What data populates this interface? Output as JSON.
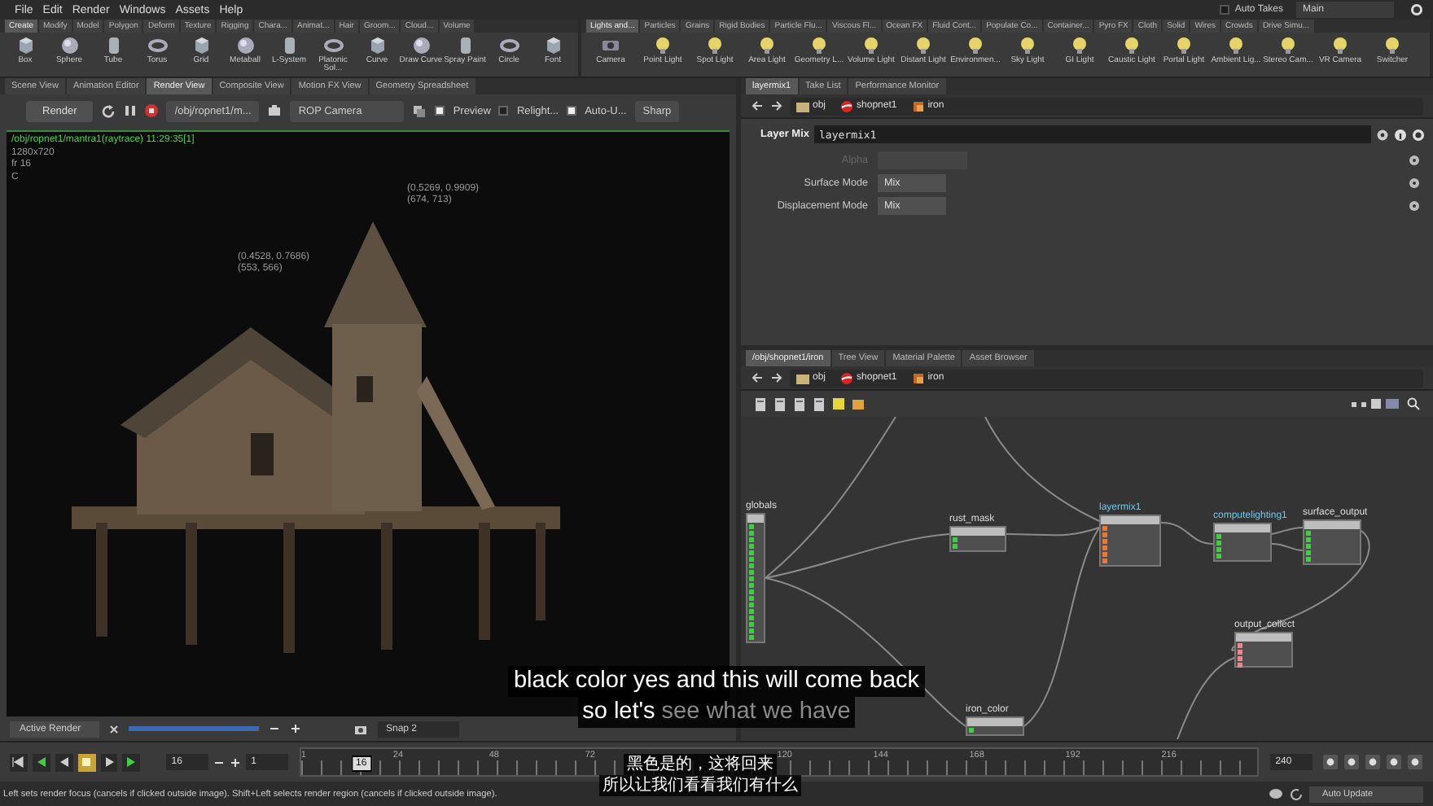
{
  "menu": [
    "File",
    "Edit",
    "Render",
    "Windows",
    "Assets",
    "Help"
  ],
  "auto_takes": {
    "label": "Auto Takes",
    "checked": false
  },
  "desktop": "Main",
  "shelves": [
    {
      "tabs": [
        {
          "label": "Create",
          "selected": true
        },
        {
          "label": "Modify",
          "selected": false
        },
        {
          "label": "Model",
          "selected": false
        },
        {
          "label": "Polygon",
          "selected": false
        },
        {
          "label": "Deform",
          "selected": false
        },
        {
          "label": "Texture",
          "selected": false
        },
        {
          "label": "Rigging",
          "selected": false
        },
        {
          "label": "Chara...",
          "selected": false
        },
        {
          "label": "Animat...",
          "selected": false
        },
        {
          "label": "Hair",
          "selected": false
        },
        {
          "label": "Groom...",
          "selected": false
        },
        {
          "label": "Cloud...",
          "selected": false
        },
        {
          "label": "Volume",
          "selected": false
        }
      ],
      "tools": [
        "Box",
        "Sphere",
        "Tube",
        "Torus",
        "Grid",
        "Metaball",
        "L-System",
        "Platonic Sol...",
        "Curve",
        "Draw Curve",
        "Spray Paint",
        "Circle",
        "Font"
      ]
    },
    {
      "tabs": [
        {
          "label": "Lights and...",
          "selected": true
        },
        {
          "label": "Particles",
          "selected": false
        },
        {
          "label": "Grains",
          "selected": false
        },
        {
          "label": "Rigid Bodies",
          "selected": false
        },
        {
          "label": "Particle Flu...",
          "selected": false
        },
        {
          "label": "Viscous Fl...",
          "selected": false
        },
        {
          "label": "Ocean FX",
          "selected": false
        },
        {
          "label": "Fluid Cont...",
          "selected": false
        },
        {
          "label": "Populate Co...",
          "selected": false
        },
        {
          "label": "Container...",
          "selected": false
        },
        {
          "label": "Pyro FX",
          "selected": false
        },
        {
          "label": "Cloth",
          "selected": false
        },
        {
          "label": "Solid",
          "selected": false
        },
        {
          "label": "Wires",
          "selected": false
        },
        {
          "label": "Crowds",
          "selected": false
        },
        {
          "label": "Drive Simu...",
          "selected": false
        }
      ],
      "tools": [
        "Camera",
        "Point Light",
        "Spot Light",
        "Area Light",
        "Geometry L...",
        "Volume Light",
        "Distant Light",
        "Environmen...",
        "Sky Light",
        "GI Light",
        "Caustic Light",
        "Portal Light",
        "Ambient Lig...",
        "Stereo Cam...",
        "VR Camera",
        "Switcher"
      ]
    }
  ],
  "render_pane": {
    "tabs": [
      {
        "label": "Scene View",
        "selected": false
      },
      {
        "label": "Animation Editor",
        "selected": false
      },
      {
        "label": "Render View",
        "selected": true
      },
      {
        "label": "Composite View",
        "selected": false
      },
      {
        "label": "Motion FX View",
        "selected": false
      },
      {
        "label": "Geometry Spreadsheet",
        "selected": false
      }
    ],
    "render_button": "Render",
    "rop_path": "/obj/ropnet1/m...",
    "camera": "ROP Camera",
    "options": [
      {
        "label": "Preview",
        "checked": true
      },
      {
        "label": "Relight...",
        "checked": false
      },
      {
        "label": "Auto-U...",
        "checked": true
      }
    ],
    "quality": "Sharp",
    "info": [
      "/obj/ropnet1/mantra1(raytrace) 11:29:35[1]",
      "1280x720",
      "fr 16",
      "C"
    ],
    "probes": [
      [
        "(0.5269, 0.9909)",
        "(674, 713)"
      ],
      [
        "(0.4528, 0.7686)",
        "(553, 566)"
      ]
    ],
    "active_render": "Active Render",
    "progress": {
      "level": 1
    },
    "snap": "Snap 2"
  },
  "param_pane": {
    "tabs": [
      {
        "label": "layermix1",
        "selected": true
      },
      {
        "label": "Take List",
        "selected": false
      },
      {
        "label": "Performance Monitor",
        "selected": false
      }
    ],
    "path": [
      "obj",
      "shopnet1",
      "iron"
    ],
    "node_type": "Layer Mix",
    "node_name": "layermix1",
    "params": [
      {
        "label": "Alpha",
        "disabled": true
      },
      {
        "label": "Surface Mode",
        "value": "Mix",
        "disabled": false
      },
      {
        "label": "Displacement Mode",
        "value": "Mix",
        "disabled": false
      }
    ]
  },
  "network_pane": {
    "tabs": [
      {
        "label": "/obj/shopnet1/iron",
        "selected": true
      },
      {
        "label": "Tree View",
        "selected": false
      },
      {
        "label": "Material Palette",
        "selected": false
      },
      {
        "label": "Asset Browser",
        "selected": false
      }
    ],
    "path": [
      "obj",
      "shopnet1",
      "iron"
    ],
    "nodes": [
      {
        "name": "globals",
        "kind": "globals"
      },
      {
        "name": "rust_mask",
        "kind": "small"
      },
      {
        "name": "layermix1",
        "kind": "mix"
      },
      {
        "name": "computelighting1",
        "kind": "light"
      },
      {
        "name": "surface_output",
        "kind": "output"
      },
      {
        "name": "output_collect",
        "kind": "collect"
      },
      {
        "name": "iron_color",
        "kind": "small"
      }
    ]
  },
  "timeline": {
    "frame": "16",
    "start": "1",
    "end": "240",
    "current": "16",
    "level": 0.063,
    "ticks": [
      "1",
      "24",
      "48",
      "72",
      "120",
      "144",
      "168",
      "192",
      "216"
    ]
  },
  "status": {
    "message": "Left sets render focus (cancels if clicked outside image). Shift+Left selects render region (cancels if clicked outside image).",
    "update_mode": "Auto Update"
  },
  "subtitles": {
    "english": [
      [
        {
          "text": "black color yes and this will come back",
          "spoken": true
        }
      ],
      [
        {
          "text": "so let's",
          "spoken": true
        },
        {
          "text": "see what we have",
          "spoken": false
        }
      ]
    ],
    "chinese": [
      "黑色是的，这将回来",
      "所以让我们看看我们有什么"
    ]
  }
}
